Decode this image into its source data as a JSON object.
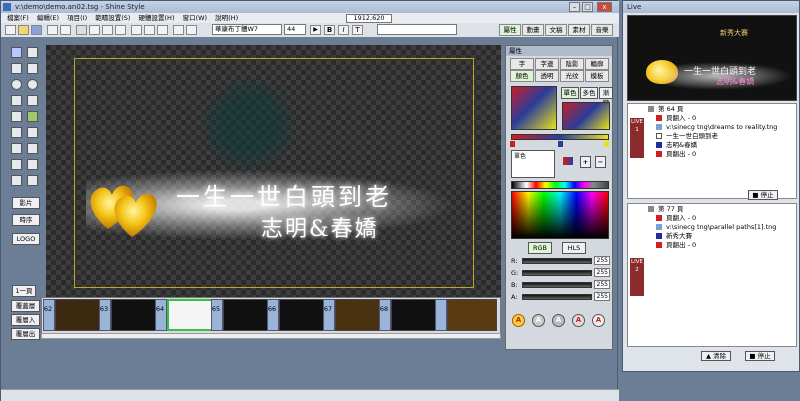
{
  "main_window": {
    "title": "v:\\demo\\demo.an02.tsg - Shine Style",
    "coords": "1912,620",
    "menu": [
      "檔案(F)",
      "編輯(E)",
      "項目(I)",
      "範疇設置(S)",
      "硬體設置(H)",
      "窗口(W)",
      "說明(H)"
    ],
    "font_name": "華康布丁體W7",
    "font_size": "44",
    "style_buttons": [
      "B",
      "I",
      "T"
    ],
    "right_tabs": [
      "屬性",
      "動畫",
      "文稿",
      "素材",
      "音樂"
    ]
  },
  "canvas": {
    "headline": "一生一世白頭到老",
    "subline": "志明&春嬌"
  },
  "left_panel": {
    "buttons": [
      "影片",
      "時序",
      "LOGO"
    ],
    "page_button": "1一頁"
  },
  "layer_buttons": [
    "覆蓋層",
    "覆層入",
    "覆層出"
  ],
  "timeline": {
    "numbers": [
      "62",
      "63",
      "64",
      "65",
      "66",
      "67",
      "68"
    ]
  },
  "properties": {
    "title": "屬性",
    "tabs_row1": [
      "字",
      "字邊",
      "陰影",
      "輪廓"
    ],
    "tabs_row2": [
      "顏色",
      "透明",
      "光纹",
      "模板"
    ],
    "side_buttons": [
      "單色",
      "多色",
      "漸變"
    ],
    "mode_label": "單色",
    "color_modes": [
      "RGB",
      "HLS"
    ],
    "channels": [
      {
        "label": "R:",
        "value": "255"
      },
      {
        "label": "G:",
        "value": "255"
      },
      {
        "label": "B:",
        "value": "255"
      },
      {
        "label": "A:",
        "value": "255"
      }
    ],
    "round_buttons": [
      "A",
      "A",
      "A",
      "A",
      "A"
    ]
  },
  "live_window": {
    "title": "Live",
    "preview_title": "新秀大賽",
    "preview_headline": "一生一世白頭到老",
    "preview_subline": "志明&春嬌",
    "group1": {
      "label": "LIVE\n1",
      "items": [
        "第 64 頁",
        "頁翻入 - 0",
        "v:\\sinecg tng\\dreams to reality.tng",
        "一生一世白頭到老",
        "志明&春嬌",
        "頁翻出 - 0"
      ],
      "stop": "停止"
    },
    "group2": {
      "label": "LIVE\n2",
      "items": [
        "第 77 頁",
        "頁翻入 - 0",
        "v:\\sinecg tng\\parallel paths[1].tng",
        "新秀大賽",
        "頁翻出 - 0"
      ],
      "clear": "清除",
      "stop": "停止"
    }
  },
  "colors": {
    "accent": "#3a6db8",
    "live_red": "#8b2b2b",
    "selected_thumb": "#39c040"
  }
}
